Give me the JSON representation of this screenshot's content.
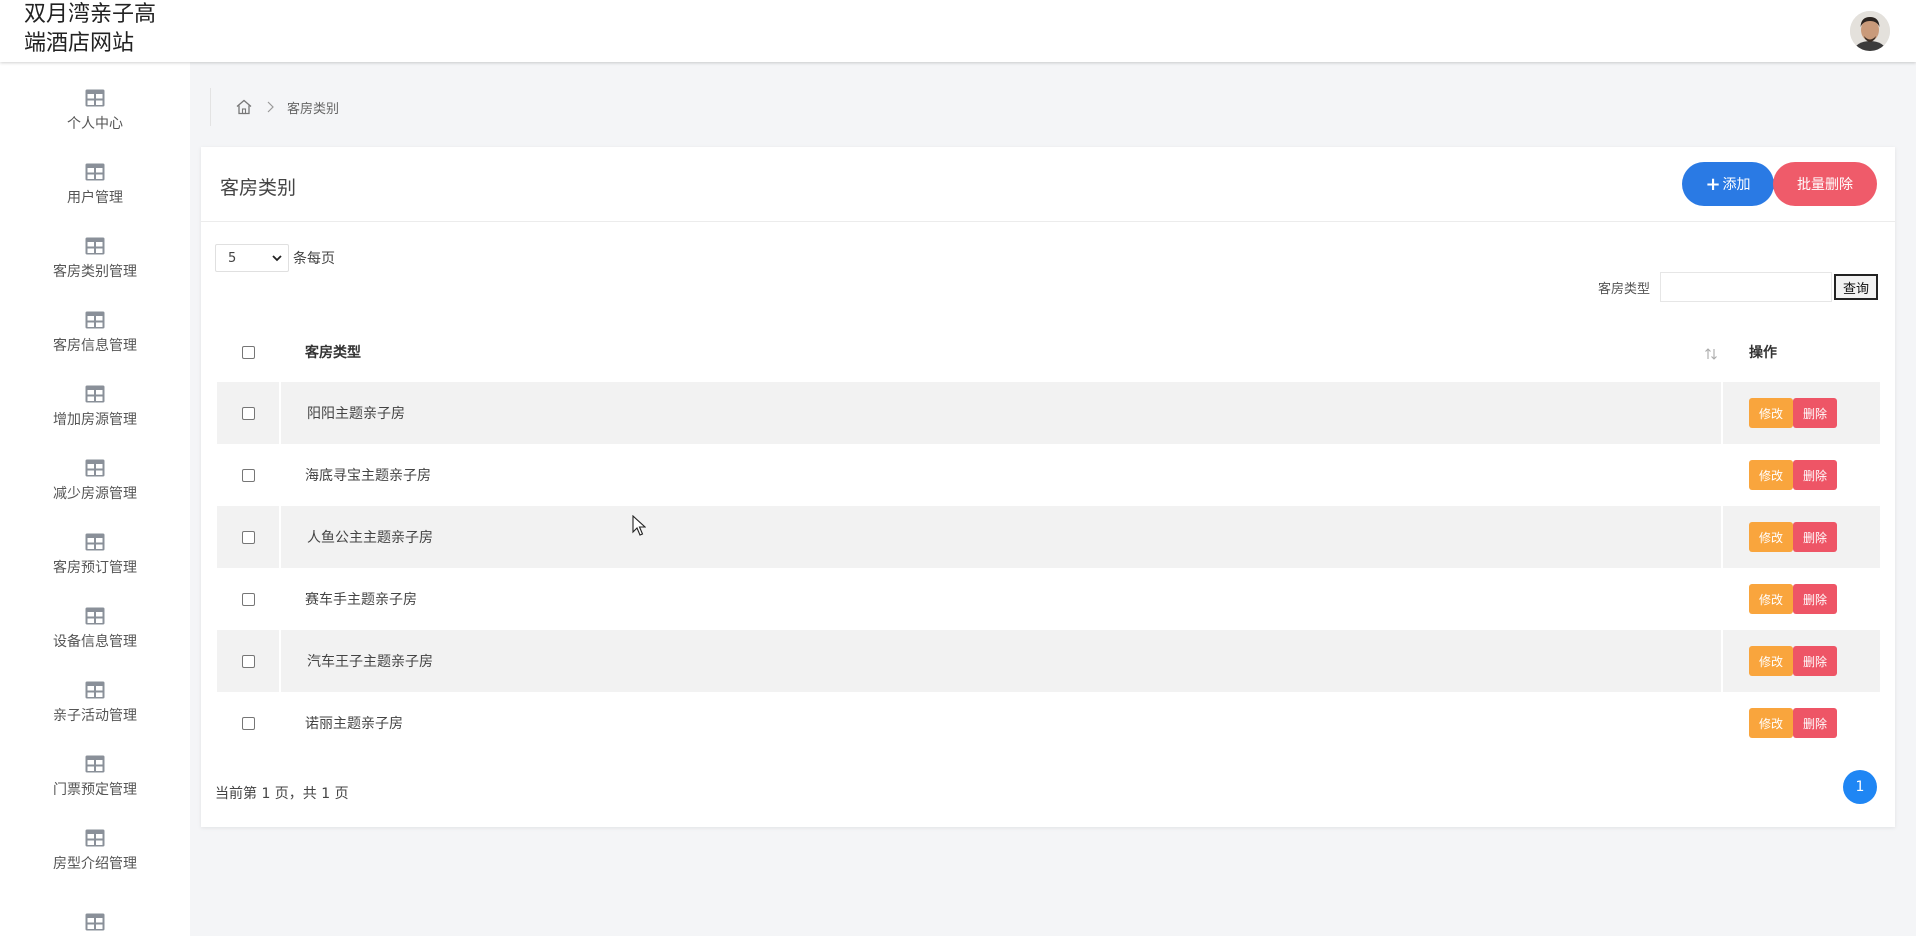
{
  "header": {
    "title": "双月湾亲子高端酒店网站",
    "avatar": "user-avatar"
  },
  "sidebar": {
    "items": [
      {
        "label": "个人中心",
        "icon": "table-icon"
      },
      {
        "label": "用户管理",
        "icon": "table-icon"
      },
      {
        "label": "客房类别管理",
        "icon": "table-icon"
      },
      {
        "label": "客房信息管理",
        "icon": "table-icon"
      },
      {
        "label": "增加房源管理",
        "icon": "table-icon"
      },
      {
        "label": "减少房源管理",
        "icon": "table-icon"
      },
      {
        "label": "客房预订管理",
        "icon": "table-icon"
      },
      {
        "label": "设备信息管理",
        "icon": "table-icon"
      },
      {
        "label": "亲子活动管理",
        "icon": "table-icon"
      },
      {
        "label": "门票预定管理",
        "icon": "table-icon"
      },
      {
        "label": "房型介绍管理",
        "icon": "table-icon"
      },
      {
        "label": "",
        "icon": "table-icon"
      }
    ]
  },
  "breadcrumb": {
    "home_icon": "home-icon",
    "current": "客房类别"
  },
  "card": {
    "title": "客房类别",
    "add_label": "添加",
    "batch_delete_label": "批量删除"
  },
  "page_size": {
    "value": "5",
    "suffix": "条每页"
  },
  "search": {
    "label": "客房类型",
    "value": "",
    "button": "查询"
  },
  "table": {
    "columns": {
      "name": "客房类型",
      "operation": "操作"
    },
    "rows": [
      {
        "name": "阳阳主题亲子房",
        "edit": "修改",
        "delete": "删除"
      },
      {
        "name": "海底寻宝主题亲子房",
        "edit": "修改",
        "delete": "删除"
      },
      {
        "name": "人鱼公主主题亲子房",
        "edit": "修改",
        "delete": "删除"
      },
      {
        "name": "赛车手主题亲子房",
        "edit": "修改",
        "delete": "删除"
      },
      {
        "name": "汽车王子主题亲子房",
        "edit": "修改",
        "delete": "删除"
      },
      {
        "name": "诺丽主题亲子房",
        "edit": "修改",
        "delete": "删除"
      }
    ]
  },
  "pagination": {
    "info": "当前第 1 页，共 1 页",
    "current": "1"
  },
  "colors": {
    "primary": "#2a7ae4",
    "danger": "#ef5b6a",
    "warning": "#f9a53d",
    "page_active": "#1f86f4"
  }
}
